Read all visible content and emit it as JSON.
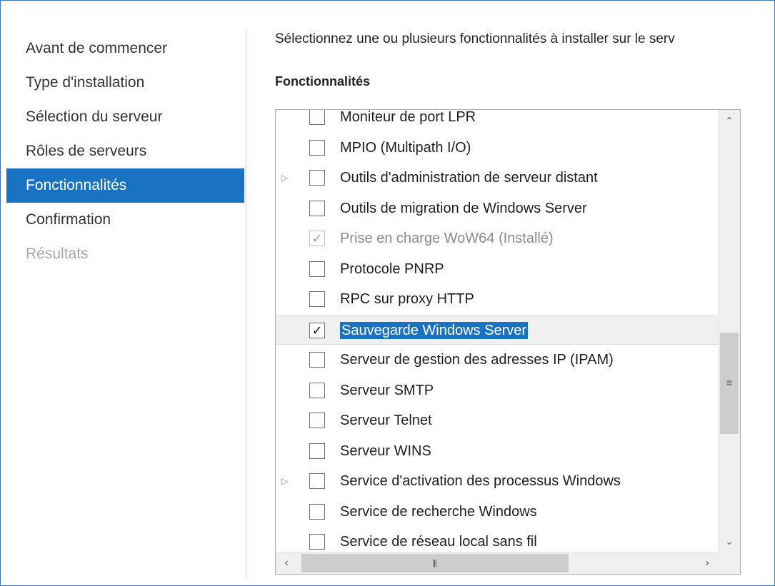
{
  "nav": {
    "items": [
      {
        "label": "Avant de commencer",
        "state": "normal"
      },
      {
        "label": "Type d'installation",
        "state": "normal"
      },
      {
        "label": "Sélection du serveur",
        "state": "normal"
      },
      {
        "label": "Rôles de serveurs",
        "state": "normal"
      },
      {
        "label": "Fonctionnalités",
        "state": "active"
      },
      {
        "label": "Confirmation",
        "state": "normal"
      },
      {
        "label": "Résultats",
        "state": "disabled"
      }
    ]
  },
  "main": {
    "instruction": "Sélectionnez une ou plusieurs fonctionnalités à installer sur le serv",
    "section_label": "Fonctionnalités"
  },
  "features": {
    "items": [
      {
        "label": "Moniteur de port LPR",
        "checked": false,
        "expandable": false
      },
      {
        "label": "MPIO (Multipath I/O)",
        "checked": false,
        "expandable": false
      },
      {
        "label": "Outils d'administration de serveur distant",
        "checked": false,
        "expandable": true
      },
      {
        "label": "Outils de migration de Windows Server",
        "checked": false,
        "expandable": false
      },
      {
        "label": "Prise en charge WoW64 (Installé)",
        "checked": true,
        "installed": true,
        "expandable": false
      },
      {
        "label": "Protocole PNRP",
        "checked": false,
        "expandable": false
      },
      {
        "label": "RPC sur proxy HTTP",
        "checked": false,
        "expandable": false
      },
      {
        "label": "Sauvegarde Windows Server",
        "checked": true,
        "selected": true,
        "expandable": false
      },
      {
        "label": "Serveur de gestion des adresses IP (IPAM)",
        "checked": false,
        "expandable": false
      },
      {
        "label": "Serveur SMTP",
        "checked": false,
        "expandable": false
      },
      {
        "label": "Serveur Telnet",
        "checked": false,
        "expandable": false
      },
      {
        "label": "Serveur WINS",
        "checked": false,
        "expandable": false
      },
      {
        "label": "Service d'activation des processus Windows",
        "checked": false,
        "expandable": true
      },
      {
        "label": "Service de recherche Windows",
        "checked": false,
        "expandable": false
      },
      {
        "label": "Service de réseau local sans fil",
        "checked": false,
        "expandable": false
      }
    ]
  },
  "icons": {
    "expander": "chevron-right-icon",
    "check": "checkmark-icon",
    "scroll_up": "chevron-up-icon",
    "scroll_down": "chevron-down-icon",
    "scroll_left": "chevron-left-icon",
    "scroll_right": "chevron-right-icon"
  },
  "colors": {
    "accent": "#1a73c2",
    "frame_border": "#3a76b8",
    "disabled_text": "#a6a6a6"
  }
}
